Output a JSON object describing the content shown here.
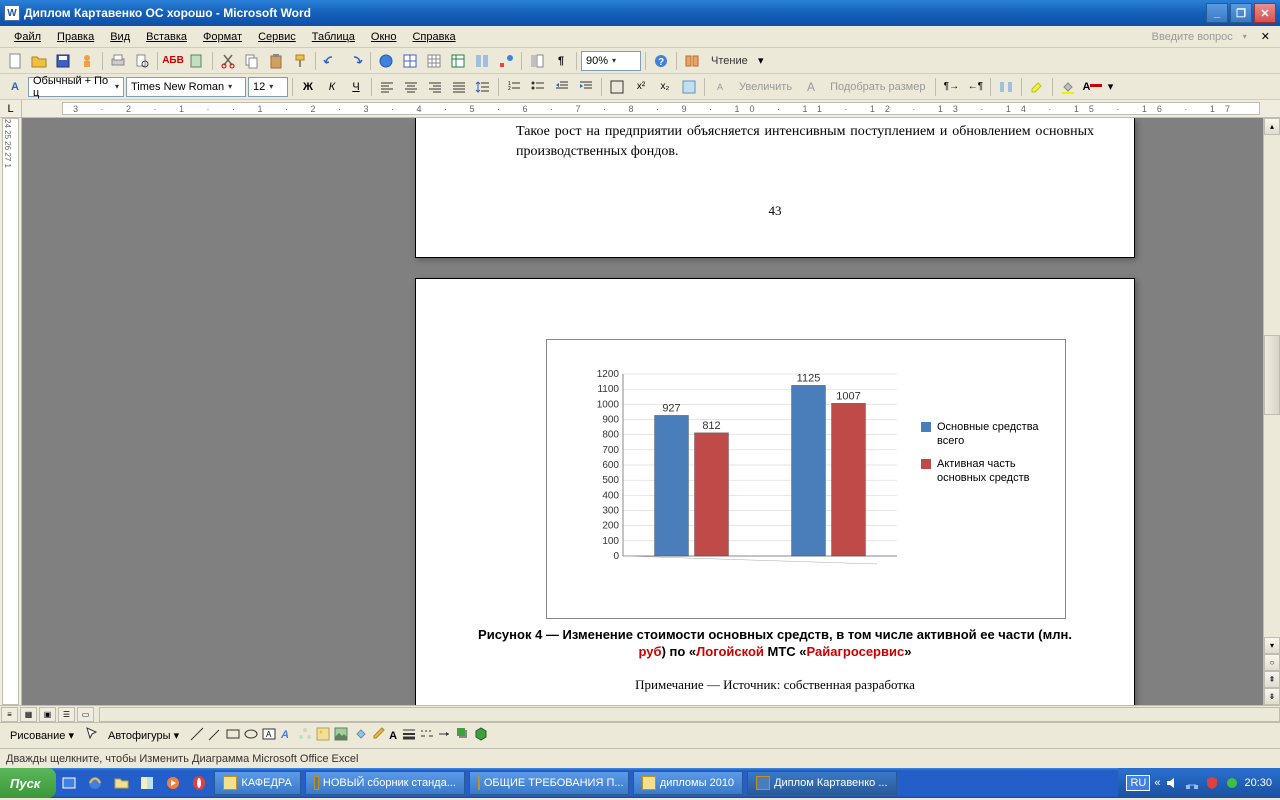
{
  "window": {
    "title": "Диплом Картавенко ОС хорошо - Microsoft Word",
    "app_icon": "W"
  },
  "menu": {
    "items": [
      "Файл",
      "Правка",
      "Вид",
      "Вставка",
      "Формат",
      "Сервис",
      "Таблица",
      "Окно",
      "Справка"
    ],
    "question_placeholder": "Введите вопрос"
  },
  "toolbar1": {
    "zoom": "90%",
    "read_label": "Чтение"
  },
  "toolbar2": {
    "style": "Обычный + По ц",
    "font": "Times New Roman",
    "size": "12",
    "zoom_in": "Увеличить",
    "fit": "Подобрать размер"
  },
  "ruler": {
    "h_marks": "3 · 2 · 1 ·   · 1 · 2 · 3 · 4 · 5 · 6 · 7 · 8 · 9 · 10 · 11 · 12 · 13 · 14 · 15 · 16 · 17",
    "v_marks": "24 25 26 27 1"
  },
  "doc": {
    "para1": "Такое рост на предприятии объясняется интенсивным поступлением и обновлением основных производственных фондов.",
    "pagenum": "43",
    "caption_a": "Рисунок 4 — Изменение стоимости основных средств, в том числе активной ее части (млн. ",
    "caption_b": "руб",
    "caption_c": ") по «",
    "caption_d": "Логойской",
    "caption_e": " МТС «",
    "caption_f": "Райагросервис",
    "caption_g": "»",
    "note": "Примечание — Источник: собственная разработка"
  },
  "chart_data": {
    "type": "bar",
    "categories": [
      "",
      ""
    ],
    "series": [
      {
        "name": "Основные средства всего",
        "values": [
          927,
          1125
        ],
        "color": "#4a7ebb"
      },
      {
        "name": "Активная часть основных средств",
        "values": [
          812,
          1007
        ],
        "color": "#be4b48"
      }
    ],
    "ylim": [
      0,
      1200
    ],
    "ystep": 100,
    "yticks": [
      0,
      100,
      200,
      300,
      400,
      500,
      600,
      700,
      800,
      900,
      1000,
      1100,
      1200
    ],
    "title": "",
    "xlabel": "",
    "ylabel": ""
  },
  "drawbar": {
    "draw": "Рисование",
    "autoshapes": "Автофигуры"
  },
  "statusbar": {
    "text": "Дважды щелкните, чтобы Изменить Диаграмма Microsoft Office Excel"
  },
  "taskbar": {
    "start": "Пуск",
    "tasks": [
      {
        "label": "КАФЕДРА",
        "type": "folder"
      },
      {
        "label": "НОВЫЙ сборник станда...",
        "type": "word"
      },
      {
        "label": "ОБЩИЕ ТРЕБОВАНИЯ П...",
        "type": "word"
      },
      {
        "label": "дипломы 2010",
        "type": "folder"
      },
      {
        "label": "Диплом Картавенко ...",
        "type": "word",
        "active": true
      }
    ],
    "lang": "RU",
    "time": "20:30"
  }
}
